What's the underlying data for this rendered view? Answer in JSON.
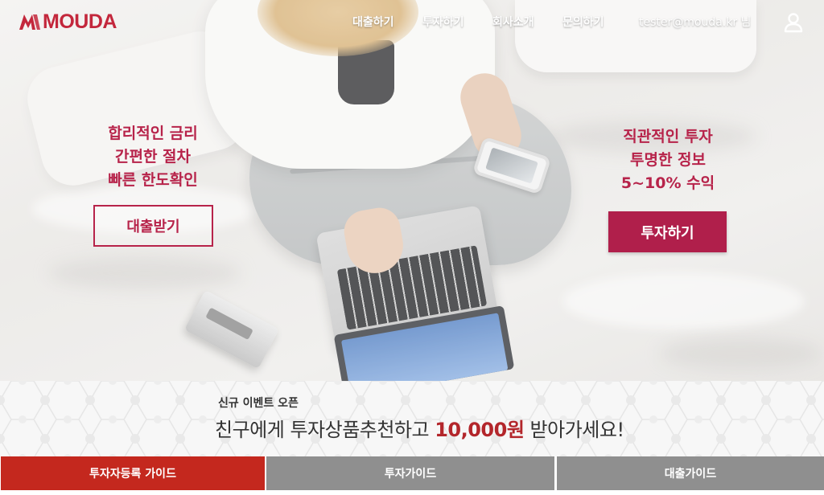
{
  "brand": {
    "name": "MOUDA",
    "color": "#c3273c"
  },
  "nav": {
    "items": [
      {
        "label": "대출하기"
      },
      {
        "label": "투자하기"
      },
      {
        "label": "회사소개"
      },
      {
        "label": "문의하기"
      }
    ],
    "user_email": "tester@mouda.kr 님",
    "user_icon": "user-icon"
  },
  "hero": {
    "loan": {
      "lines": [
        "합리적인 금리",
        "간편한 절차",
        "빠른 한도확인"
      ],
      "button_label": "대출받기"
    },
    "invest": {
      "lines": [
        "직관적인 투자",
        "투명한 정보",
        "5~10% 수익"
      ],
      "button_label": "투자하기"
    },
    "accent_color": "#b7234a"
  },
  "event": {
    "small_title": "신규 이벤트 오픈",
    "main_prefix": "친구에게 투자상품추천하고 ",
    "main_amount": "10,000원",
    "main_suffix": " 받아가세요!"
  },
  "guides": {
    "tabs": [
      {
        "label": "투자자등록 가이드",
        "active": true,
        "color": "#c4281e"
      },
      {
        "label": "투자가이드",
        "active": false,
        "color": "#8f8f8f"
      },
      {
        "label": "대출가이드",
        "active": false,
        "color": "#8f8f8f"
      }
    ]
  }
}
